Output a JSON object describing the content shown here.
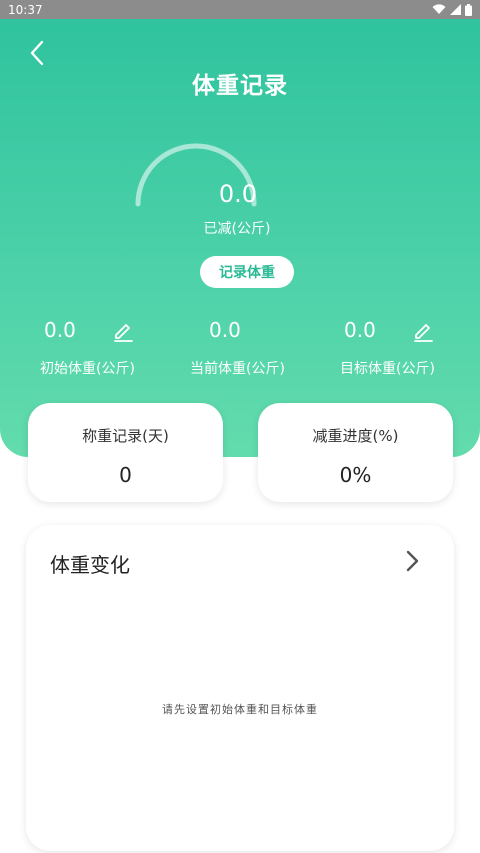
{
  "status_bar": {
    "time": "10:37"
  },
  "header": {
    "title": "体重记录",
    "back_icon": "chevron-left-icon"
  },
  "summary": {
    "lost_value": "0.0",
    "lost_label": "已减(公斤)",
    "progress": 0
  },
  "record_button": {
    "label": "记录体重"
  },
  "stats": [
    {
      "value": "0.0",
      "label": "初始体重(公斤)",
      "editable": true
    },
    {
      "value": "0.0",
      "label": "当前体重(公斤)",
      "editable": false
    },
    {
      "value": "0.0",
      "label": "目标体重(公斤)",
      "editable": true
    }
  ],
  "cards": {
    "records": {
      "title": "称重记录(天)",
      "value": "0"
    },
    "progress": {
      "title": "减重进度(%)",
      "value": "0%"
    }
  },
  "trend": {
    "title": "体重变化",
    "empty_text": "请先设置初始体重和目标体重",
    "arrow_icon": "chevron-right-icon"
  },
  "colors": {
    "accent": "#2fc39e",
    "accent_light": "#63dcad",
    "button_text": "#2aba95"
  }
}
